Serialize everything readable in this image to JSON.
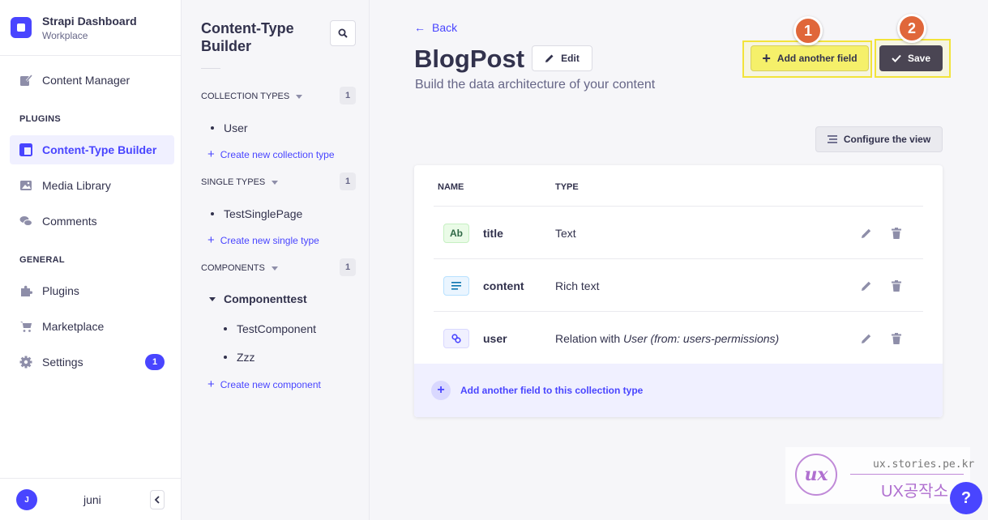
{
  "brand": {
    "title": "Strapi Dashboard",
    "subtitle": "Workplace"
  },
  "nav": {
    "content_manager": "Content Manager",
    "plugins_section": "PLUGINS",
    "content_type_builder": "Content-Type Builder",
    "media_library": "Media Library",
    "comments": "Comments",
    "general_section": "GENERAL",
    "plugins": "Plugins",
    "marketplace": "Marketplace",
    "settings": "Settings",
    "settings_badge": "1"
  },
  "user": {
    "initial": "J",
    "name": "juni"
  },
  "subnav": {
    "title": "Content-Type Builder",
    "collection_types": {
      "label": "COLLECTION TYPES",
      "count": "1",
      "items": [
        "User"
      ],
      "create": "Create new collection type"
    },
    "single_types": {
      "label": "SINGLE TYPES",
      "count": "1",
      "items": [
        "TestSinglePage"
      ],
      "create": "Create new single type"
    },
    "components": {
      "label": "COMPONENTS",
      "count": "1",
      "group": "Componenttest",
      "items": [
        "TestComponent",
        "Zzz"
      ],
      "create": "Create new component"
    }
  },
  "header": {
    "back": "Back",
    "title": "BlogPost",
    "edit": "Edit",
    "subtitle": "Build the data architecture of your content",
    "add_field": "Add another field",
    "save": "Save",
    "step1": "1",
    "step2": "2",
    "configure_view": "Configure the view"
  },
  "table": {
    "col_name": "NAME",
    "col_type": "TYPE",
    "rows": [
      {
        "icon": "Ab",
        "name": "title",
        "type": "Text"
      },
      {
        "icon": "rich-text-icon",
        "name": "content",
        "type": "Rich text"
      },
      {
        "icon": "relation-icon",
        "name": "user",
        "type_prefix": "Relation with ",
        "type_italic": "User (from: users-permissions)"
      }
    ],
    "add_row": "Add another field to this collection type"
  },
  "watermark": {
    "url": "ux.stories.pe.kr",
    "name": "UX공작소",
    "logo": "ux"
  },
  "help": "?"
}
